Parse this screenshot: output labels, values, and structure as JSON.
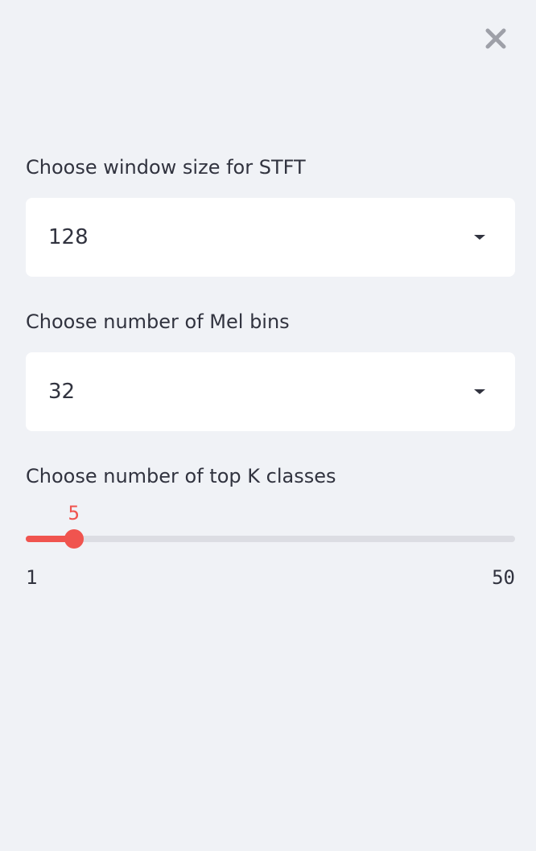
{
  "close_button": {
    "icon": "close-icon"
  },
  "controls": [
    {
      "label": "Choose window size for STFT",
      "value": "128",
      "icon": "caret-down-icon"
    },
    {
      "label": "Choose number of Mel bins",
      "value": "32",
      "icon": "caret-down-icon"
    }
  ],
  "slider": {
    "label": "Choose number of top K classes",
    "value": "5",
    "min": "1",
    "max": "50"
  },
  "colors": {
    "background": "#f0f2f6",
    "text": "#31333f",
    "accent": "#f0544f",
    "track": "#dcdde3",
    "close_icon": "#9ea0a8"
  }
}
